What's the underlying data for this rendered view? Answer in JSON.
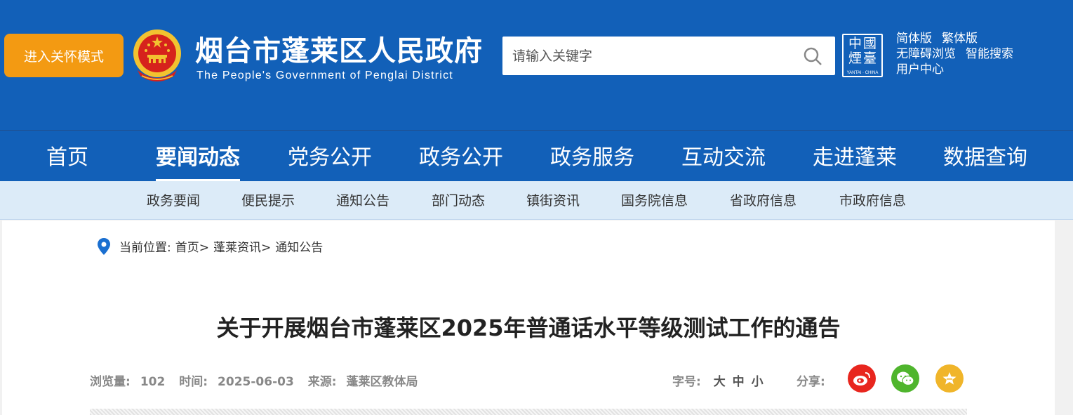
{
  "header": {
    "care_mode_label": "进入关怀模式",
    "site_title": "烟台市蓬莱区人民政府",
    "site_subtitle": "The People's Government of Penglai District",
    "search_placeholder": "请输入关键字",
    "china_logo_text": "中國煙臺",
    "china_logo_sub": "YANTAI · CHINA",
    "links": [
      "简体版",
      "繁体版",
      "无障碍浏览",
      "智能搜索",
      "用户中心"
    ]
  },
  "nav": {
    "items": [
      "首页",
      "要闻动态",
      "党务公开",
      "政务公开",
      "政务服务",
      "互动交流",
      "走进蓬莱",
      "数据查询"
    ],
    "active": "要闻动态"
  },
  "subnav": {
    "items": [
      "政务要闻",
      "便民提示",
      "通知公告",
      "部门动态",
      "镇街资讯",
      "国务院信息",
      "省政府信息",
      "市政府信息"
    ]
  },
  "breadcrumb": {
    "label": "当前位置:",
    "items": [
      "首页>",
      "蓬莱资讯>",
      "通知公告"
    ]
  },
  "article": {
    "title": "关于开展烟台市蓬莱区2025年普通话水平等级测试工作的通告",
    "views_label": "浏览量:",
    "views": "102",
    "time_label": "时间:",
    "time": "2025-06-03",
    "source_label": "来源:",
    "source": "蓬莱区教体局",
    "fontsize_label": "字号:",
    "fontsize_options": [
      "大",
      "中",
      "小"
    ],
    "share_label": "分享:"
  },
  "colors": {
    "header_blue": "#1260b8",
    "care_orange": "#f39a12",
    "subnav_bg": "#dcebf8",
    "weibo": "#e8261e",
    "wechat": "#4fb52d",
    "favorite": "#f0b52a"
  },
  "icons": [
    "national-emblem-icon",
    "search-icon",
    "location-pin-icon",
    "weibo-icon",
    "wechat-icon",
    "star-icon"
  ]
}
